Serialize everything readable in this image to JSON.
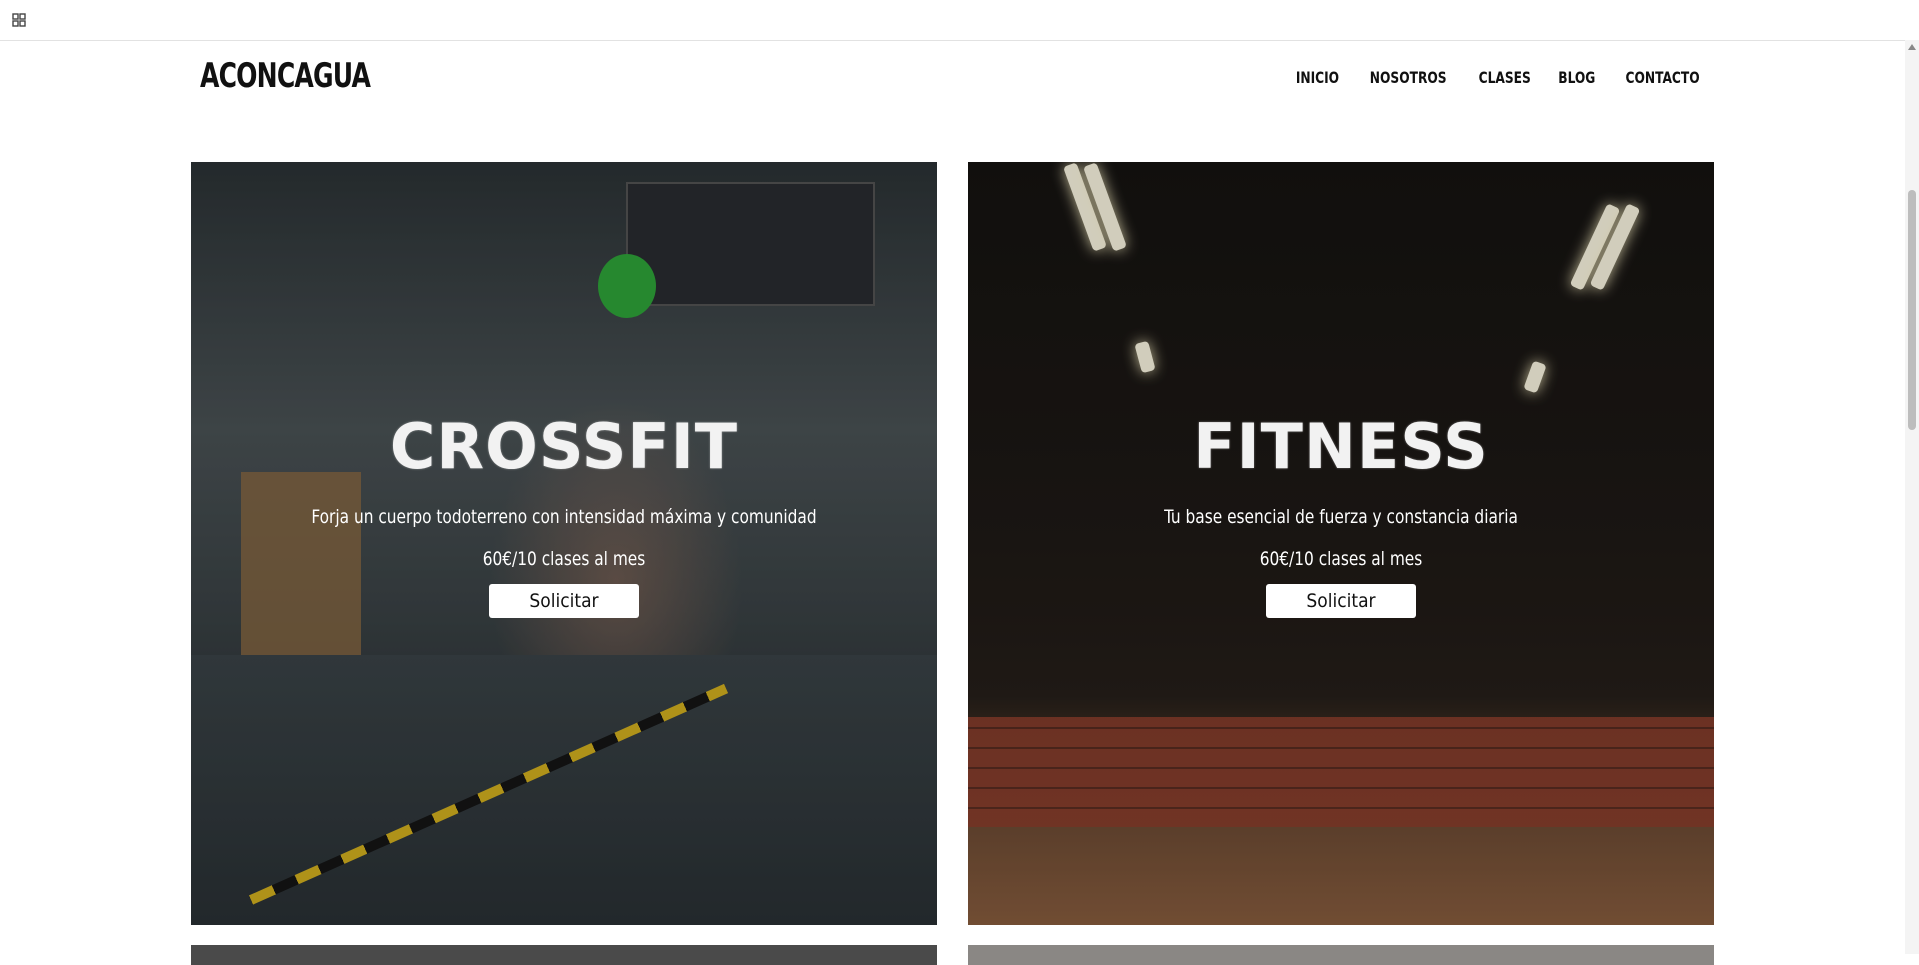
{
  "site": {
    "logo": "ACONCAGUA",
    "nav": [
      "INICIO",
      "NOSOTROS",
      "CLASES",
      "BLOG",
      "CONTACTO"
    ]
  },
  "cards": [
    {
      "title": "CROSSFIT",
      "description": "Forja un cuerpo todoterreno con intensidad máxima y comunidad",
      "price": "60€/10 clases al mes",
      "button": "Solicitar"
    },
    {
      "title": "FITNESS",
      "description": "Tu base esencial de fuerza y constancia diaria",
      "price": "60€/10 clases al mes",
      "button": "Solicitar"
    }
  ],
  "icons": {
    "apps": "grid-icon"
  }
}
